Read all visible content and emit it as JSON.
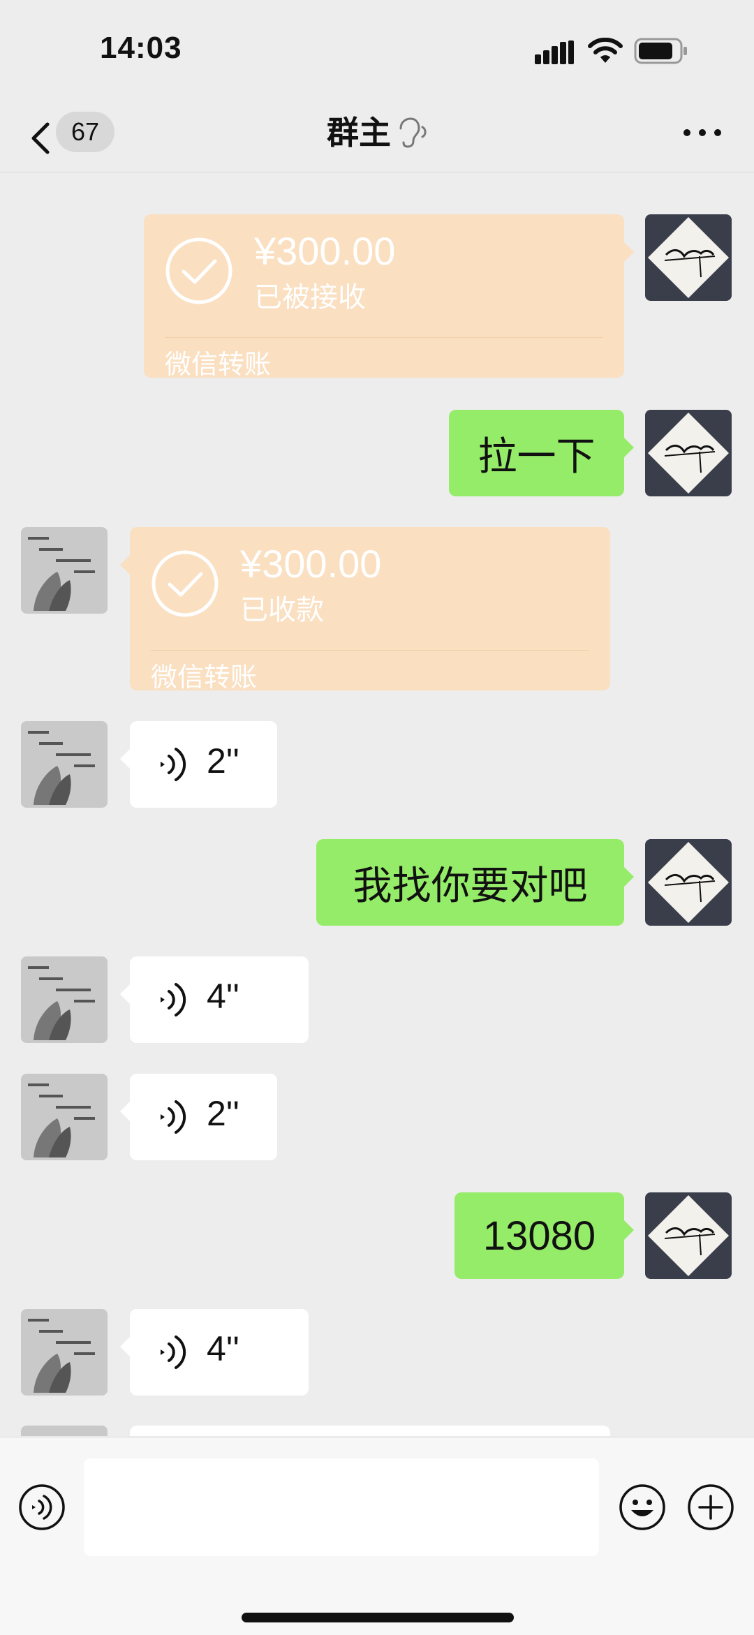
{
  "status_bar": {
    "time": "14:03"
  },
  "header": {
    "unread_count": "67",
    "title": "群主",
    "earpiece_icon": "ear-icon",
    "more_icon": "more-dots-icon",
    "back_icon": "chevron-left-icon"
  },
  "colors": {
    "background": "#ededed",
    "sent_bubble": "#95ec69",
    "received_bubble": "#ffffff",
    "transfer_card": "#fadfc1"
  },
  "messages": [
    {
      "from": "me",
      "type": "transfer",
      "amount": "¥300.00",
      "status": "已被接收",
      "footer": "微信转账"
    },
    {
      "from": "me",
      "type": "text",
      "text": "拉一下"
    },
    {
      "from": "other",
      "type": "transfer",
      "amount": "¥300.00",
      "status": "已收款",
      "footer": "微信转账"
    },
    {
      "from": "other",
      "type": "voice",
      "duration": "2''"
    },
    {
      "from": "me",
      "type": "text",
      "text": "我找你要对吧"
    },
    {
      "from": "other",
      "type": "voice",
      "duration": "4''"
    },
    {
      "from": "other",
      "type": "voice",
      "duration": "2''"
    },
    {
      "from": "me",
      "type": "text",
      "text": "13080"
    },
    {
      "from": "other",
      "type": "voice",
      "duration": "4''"
    }
  ],
  "input_bar": {
    "voice_icon": "voice-input-icon",
    "emoji_icon": "emoji-icon",
    "plus_icon": "plus-circle-icon"
  }
}
